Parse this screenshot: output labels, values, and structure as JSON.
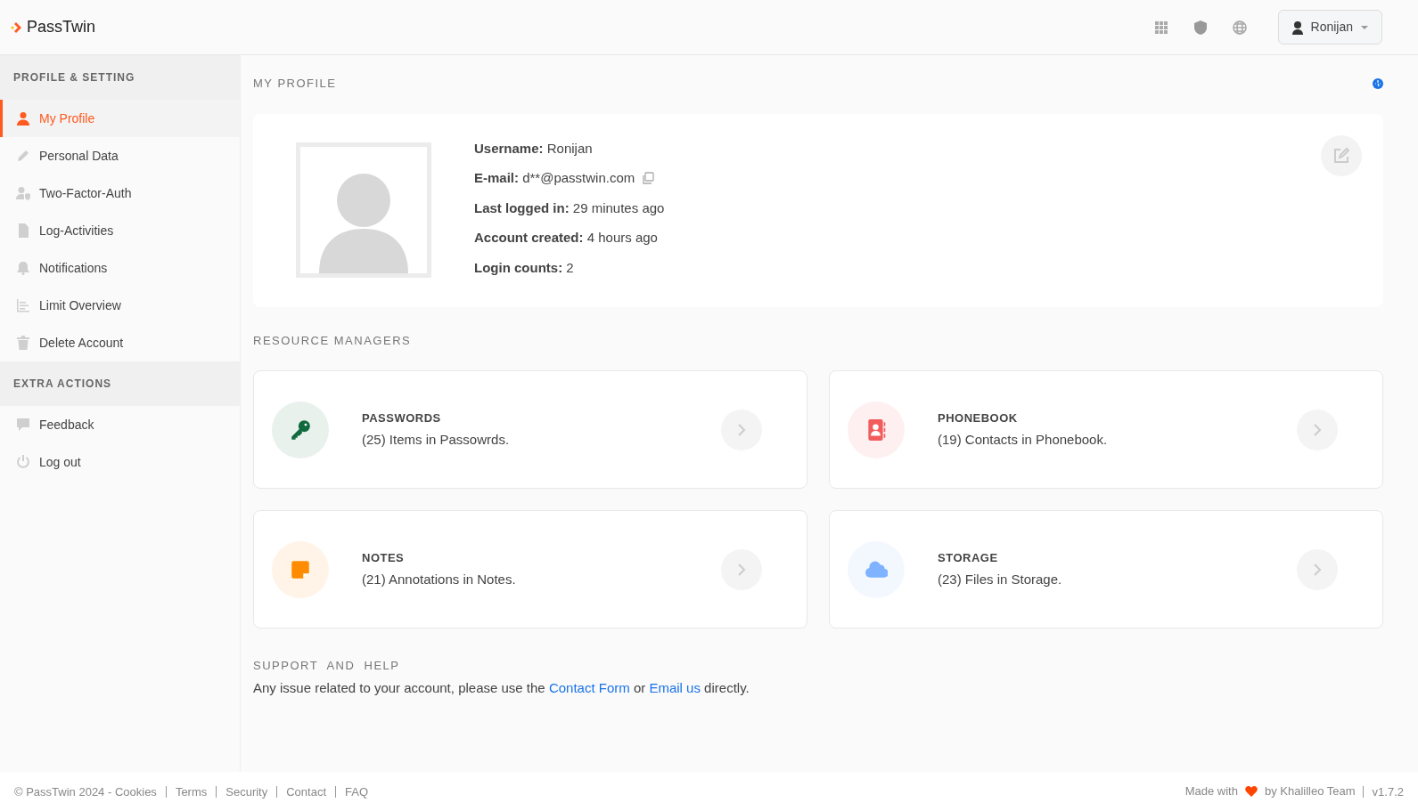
{
  "brand": {
    "name": "PassTwin"
  },
  "user_menu": {
    "label": "Ronijan"
  },
  "sidebar": {
    "sections": [
      {
        "title": "PROFILE & SETTING",
        "items": [
          {
            "label": "My Profile",
            "selected": true
          },
          {
            "label": "Personal Data",
            "selected": false
          },
          {
            "label": "Two-Factor-Auth",
            "selected": false
          },
          {
            "label": "Log-Activities",
            "selected": false
          },
          {
            "label": "Notifications",
            "selected": false
          },
          {
            "label": "Limit Overview",
            "selected": false
          },
          {
            "label": "Delete Account",
            "selected": false
          }
        ]
      },
      {
        "title": "EXTRA ACTIONS",
        "items": [
          {
            "label": "Feedback",
            "selected": false
          },
          {
            "label": "Log out",
            "selected": false
          }
        ]
      }
    ]
  },
  "profile": {
    "title": "MY PROFILE",
    "fields": [
      {
        "label": "Username:",
        "value": "Ronijan",
        "copyable": false
      },
      {
        "label": "E-mail:",
        "value": "d**@passtwin.com",
        "copyable": true
      },
      {
        "label": "Last logged in:",
        "value": "29 minutes ago",
        "copyable": false
      },
      {
        "label": "Account created:",
        "value": "4 hours ago",
        "copyable": false
      },
      {
        "label": "Login counts:",
        "value": "2",
        "copyable": false
      }
    ]
  },
  "resources": {
    "title": "RESOURCE MANAGERS",
    "cards": [
      {
        "title": "PASSWORDS",
        "description": "(25) Items in Passowrds.",
        "color": "#116a3e"
      },
      {
        "title": "PHONEBOOK",
        "description": "(19) Contacts in Phonebook.",
        "color": "#f25c5c"
      },
      {
        "title": "NOTES",
        "description": "(21) Annotations in Notes.",
        "color": "#ff8c00"
      },
      {
        "title": "STORAGE",
        "description": "(23) Files in Storage.",
        "color": "#7fb3ff"
      }
    ]
  },
  "support": {
    "title": "SUPPORT  AND  HELP",
    "parts": [
      {
        "kind": "text",
        "text": "Any issue related to your account, please use the "
      },
      {
        "kind": "link",
        "text": "Contact Form"
      },
      {
        "kind": "text",
        "text": " or "
      },
      {
        "kind": "link",
        "text": "Email us"
      },
      {
        "kind": "text",
        "text": " directly."
      }
    ]
  },
  "footer": {
    "links": [
      "© PassTwin 2024 - Cookies",
      "Terms",
      "Security",
      "Contact",
      "FAQ"
    ],
    "made_with": "Made with",
    "team": "by Khalilleo Team",
    "version": "v1.7.2"
  }
}
